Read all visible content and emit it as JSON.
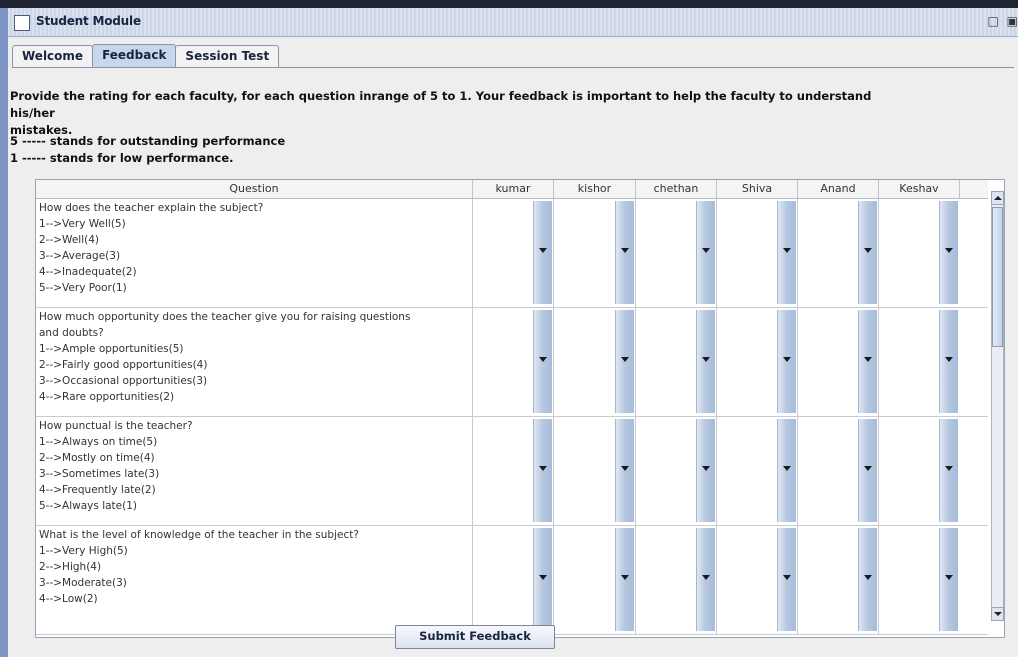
{
  "window": {
    "title": "Student Module",
    "controls": [
      "□",
      "▣"
    ]
  },
  "tabs": [
    "Welcome",
    "Feedback",
    "Session Test"
  ],
  "active_tab": "Feedback",
  "instructions": {
    "line1": "Provide the rating for each faculty, for each question inrange of 5 to 1. Your feedback is important to help the faculty to understand his/her",
    "line2": "mistakes.",
    "legend1": "5 ----- stands for outstanding performance",
    "legend2": "1 ----- stands for low performance."
  },
  "table": {
    "headers": [
      "Question",
      "kumar",
      "kishor",
      "chethan",
      "Shiva",
      "Anand",
      "Keshav"
    ],
    "rows": [
      {
        "lines": [
          "How does the teacher explain the subject?",
          "1-->Very Well(5)",
          "2-->Well(4)",
          "3-->Average(3)",
          "4-->Inadequate(2)",
          "5-->Very Poor(1)"
        ]
      },
      {
        "lines": [
          "How much opportunity does the teacher give you for raising questions",
          "and doubts?",
          "1-->Ample opportunities(5)",
          "2-->Fairly good opportunities(4)",
          "3-->Occasional opportunities(3)",
          "4-->Rare opportunities(2)"
        ]
      },
      {
        "lines": [
          "How punctual is the teacher?",
          "1-->Always on time(5)",
          "2-->Mostly on time(4)",
          "3-->Sometimes late(3)",
          "4-->Frequently late(2)",
          "5-->Always late(1)"
        ]
      },
      {
        "lines": [
          "What is the level of knowledge of the teacher in the subject?",
          "1-->Very High(5)",
          "2-->High(4)",
          "3-->Moderate(3)",
          "4-->Low(2)"
        ]
      }
    ]
  },
  "submit_label": "Submit Feedback"
}
